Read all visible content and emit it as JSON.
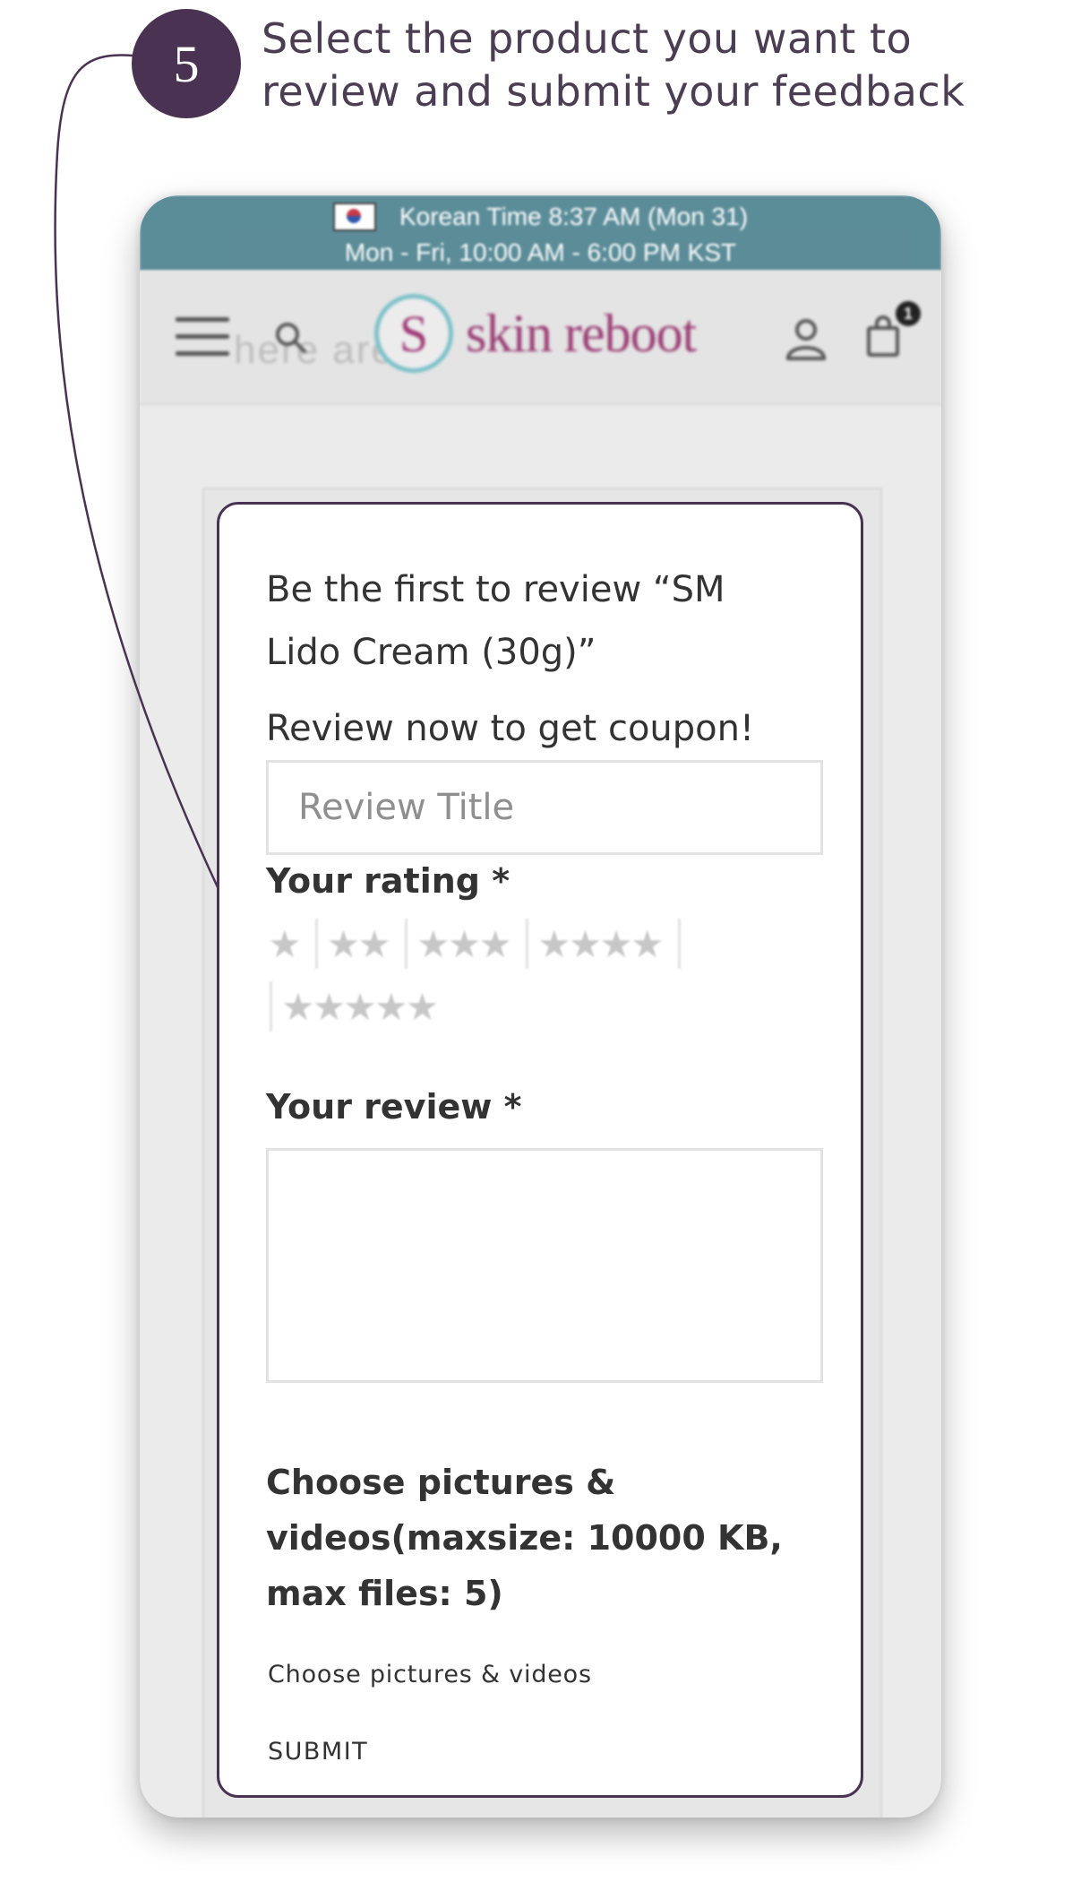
{
  "step": {
    "number": "5",
    "instruction": "Select the product you want to\nreview and submit your feedback"
  },
  "site": {
    "topbar": {
      "time": "Korean Time 8:37 AM (Mon 31)",
      "hours": "Mon - Fri, 10:00 AM - 6:00 PM KST"
    },
    "navbar": {
      "logo_mark": "S",
      "logo_text": "skin reboot",
      "cart_count": "1",
      "ghost_text": "here are"
    }
  },
  "review_form": {
    "title": "Be the first to review “SM Lido Cream (30g)”",
    "coupon_text": "Review now to get coupon!",
    "review_title_placeholder": "Review Title",
    "rating_label": "Your rating *",
    "rating_options": [
      "★",
      "★★",
      "★★★",
      "★★★★",
      "★★★★★"
    ],
    "review_label": "Your review *",
    "media_label": "Choose pictures & videos(maxsize: 10000 KB, max files: 5)",
    "choose_media_link": "Choose pictures & videos",
    "submit_label": "SUBMIT"
  },
  "colors": {
    "step_circle": "#4a3352",
    "topbar": "#4f8592",
    "logo": "#9a3d73",
    "card_border": "#4a3352"
  }
}
